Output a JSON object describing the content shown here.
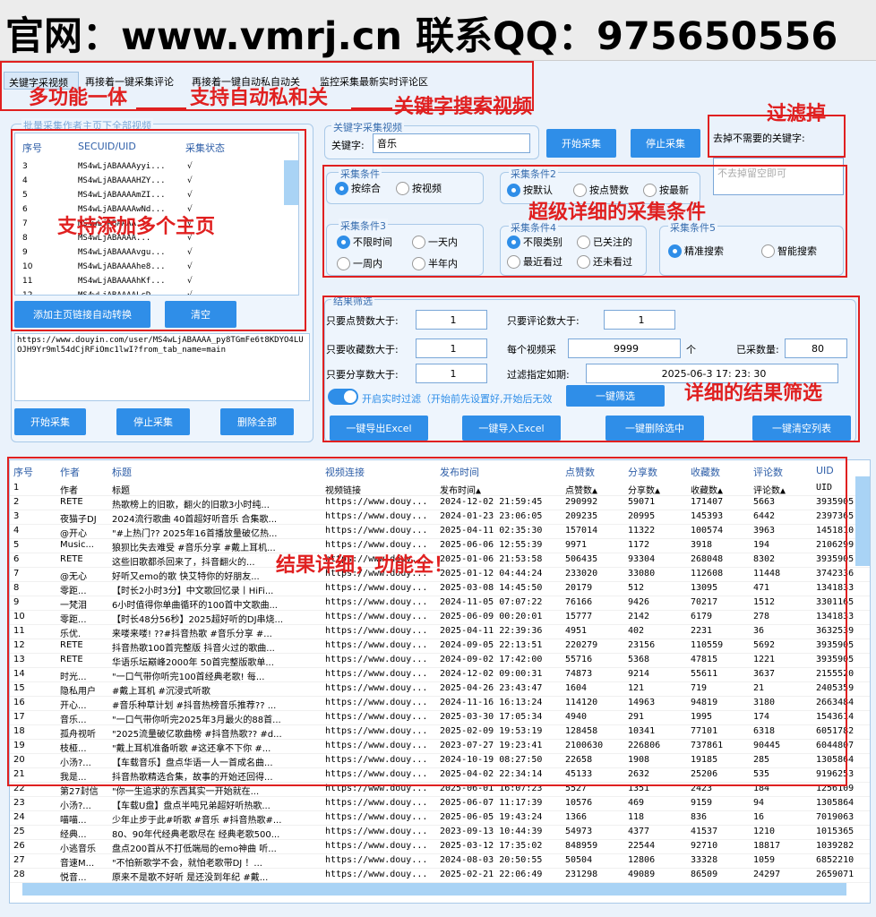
{
  "banner": "官网：www.vmrj.cn  联系QQ：975650556",
  "tabs": [
    "关键字采视频",
    "再接着一键采集评论",
    "再接着一键自动私自动关",
    "监控采集最新实时评论区"
  ],
  "annotations": {
    "multi": "多功能一体",
    "auto": "支持自动私和关",
    "keyword": "关键字搜索视频",
    "filter": "过滤掉",
    "homepage": "支持添加多个主页",
    "conditions": "超级详细的采集条件",
    "result_filter": "详细的结果筛选",
    "result_detail": "结果详细，功能全！"
  },
  "left_panel": {
    "title": "批量采集作者主页下全部视频",
    "headers": [
      "序号",
      "SECUID/UID",
      "采集状态"
    ],
    "rows": [
      {
        "no": "3",
        "uid": "MS4wLjABAAAAyyi...",
        "status": "√"
      },
      {
        "no": "4",
        "uid": "MS4wLjABAAAAHZY...",
        "status": "√"
      },
      {
        "no": "5",
        "uid": "MS4wLjABAAAAmZI...",
        "status": "√"
      },
      {
        "no": "6",
        "uid": "MS4wLjABAAAAwNd...",
        "status": "√"
      },
      {
        "no": "7",
        "uid": "MS4wLjABAAAA...",
        "status": "√"
      },
      {
        "no": "8",
        "uid": "MS4wLjABAAAA...",
        "status": "√"
      },
      {
        "no": "9",
        "uid": "MS4wLjABAAAAvgu...",
        "status": "√"
      },
      {
        "no": "10",
        "uid": "MS4wLjABAAAAhe8...",
        "status": "√"
      },
      {
        "no": "11",
        "uid": "MS4wLjABAAAAhKf...",
        "status": "√"
      },
      {
        "no": "12",
        "uid": "MS4wLjABAAAALcD...",
        "status": "√"
      }
    ],
    "add_btn": "添加主页链接自动转换",
    "clear_btn": "清空",
    "url_text": "https://www.douyin.com/user/MS4wLjABAAAA_py8TGmFe6t8KDYO4LUOJH9Yr9ml54dCjRFiOmc1lwI?from_tab_name=main",
    "start_btn": "开始采集",
    "stop_btn": "停止采集",
    "delete_btn": "删除全部"
  },
  "keyword": {
    "group": "关键字采集视频",
    "label": "关键字:",
    "value": "音乐",
    "start_btn": "开始采集",
    "stop_btn": "停止采集"
  },
  "exclude": {
    "label": "去掉不需要的关键字:",
    "placeholder": "不去掉留空即可"
  },
  "conditions": {
    "c1": {
      "title": "采集条件",
      "options": [
        "按综合",
        "按视频"
      ],
      "selected": 0
    },
    "c2": {
      "title": "采集条件2",
      "options": [
        "按默认",
        "按点赞数",
        "按最新"
      ],
      "selected": 0
    },
    "c3": {
      "title": "采集条件3",
      "options": [
        "不限时间",
        "一天内",
        "一周内",
        "半年内"
      ],
      "selected": 0
    },
    "c4": {
      "title": "采集条件4",
      "options": [
        "不限类别",
        "已关注的",
        "最近看过",
        "还未看过"
      ],
      "selected": 0
    },
    "c5": {
      "title": "采集条件5",
      "options": [
        "精准搜索",
        "智能搜索"
      ],
      "selected": 0
    }
  },
  "filter": {
    "group": "结果筛选",
    "likes_label": "只要点赞数大于:",
    "likes_value": "1",
    "comments_label": "只要评论数大于:",
    "comments_value": "1",
    "collects_label": "只要收藏数大于:",
    "collects_value": "1",
    "per_video_label": "每个视频采",
    "per_video_value": "9999",
    "per_video_unit": "个",
    "collected_label": "已采数量:",
    "collected_value": "80",
    "shares_label": "只要分享数大于:",
    "shares_value": "1",
    "expire_label": "过滤指定如期:",
    "expire_value": "2025-06-3  17: 23: 30",
    "realtime_label": "开启实时过滤（开始前先设置好,开始后无效",
    "filter_btn": "一键筛选",
    "export_btn": "一键导出Excel",
    "import_btn": "一键导入Excel",
    "delete_sel_btn": "一键删除选中",
    "clear_list_btn": "一键清空列表"
  },
  "table": {
    "headers": [
      "序号",
      "作者",
      "标题",
      "视频连接",
      "发布时间",
      "点赞数",
      "分享数",
      "收藏数",
      "评论数",
      "UID"
    ],
    "rows": [
      [
        "1",
        "作者",
        "标题",
        "视频链接",
        "发布时间▲",
        "点赞数▲",
        "分享数▲",
        "收藏数▲",
        "评论数▲",
        "UID"
      ],
      [
        "2",
        "RETE",
        "热歌榜上的旧歌，翻火的旧歌3小时纯...",
        "https://www.douy...",
        "2024-12-02 21:59:45",
        "290992",
        "59071",
        "171407",
        "5663",
        "3935905"
      ],
      [
        "3",
        "夜猫子DJ",
        "2024流行歌曲 40首超好听音乐 合集歌...",
        "https://www.douy...",
        "2024-01-23 23:06:05",
        "209235",
        "20995",
        "145393",
        "6442",
        "2397365"
      ],
      [
        "4",
        "@开心",
        "\"#上热门?? 2025年16首播放量破亿热...",
        "https://www.douy...",
        "2025-04-11 02:35:30",
        "157014",
        "11322",
        "100574",
        "3963",
        "1451810"
      ],
      [
        "5",
        "Music...",
        "狼狈比失去难受 #音乐分享 #戴上耳机...",
        "https://www.douy...",
        "2025-06-06 12:55:39",
        "9971",
        "1172",
        "3918",
        "194",
        "2106299"
      ],
      [
        "6",
        "RETE",
        "这些旧歌都杀回来了，抖音翻火的...",
        "https://www.douy...",
        "2025-01-06 21:53:58",
        "506435",
        "93304",
        "268048",
        "8302",
        "3935905"
      ],
      [
        "7",
        "@无心",
        "好听又emo的歌  快艾特你的好朋友...",
        "https://www.douy...",
        "2025-01-12 04:44:24",
        "233020",
        "33080",
        "112608",
        "11448",
        "3742336"
      ],
      [
        "8",
        "零距...",
        "【时长2小时3分】中文歌回忆录丨HiFi...",
        "https://www.douy...",
        "2025-03-08 14:45:50",
        "20179",
        "512",
        "13095",
        "471",
        "1341833"
      ],
      [
        "9",
        "一梵泪",
        "6小时值得你单曲循环的100首中文歌曲...",
        "https://www.douy...",
        "2024-11-05 07:07:22",
        "76166",
        "9426",
        "70217",
        "1512",
        "3301165"
      ],
      [
        "10",
        "零距...",
        "【时长48分56秒】2025超好听的DJ串烧...",
        "https://www.douy...",
        "2025-06-09 00:20:01",
        "15777",
        "2142",
        "6179",
        "278",
        "1341833"
      ],
      [
        "11",
        "乐优.",
        "来喽来喽! ??#抖音热歌 #音乐分享  #...",
        "https://www.douy...",
        "2025-04-11 22:39:36",
        "4951",
        "402",
        "2231",
        "36",
        "3632539"
      ],
      [
        "12",
        "RETE",
        "抖音热歌100首完整版 抖音火过的歌曲...",
        "https://www.douy...",
        "2024-09-05 22:13:51",
        "220279",
        "23156",
        "110559",
        "5692",
        "3935905"
      ],
      [
        "13",
        "RETE",
        "华语乐坛巅峰2000年 50首完整版歌单...",
        "https://www.douy...",
        "2024-09-02 17:42:00",
        "55716",
        "5368",
        "47815",
        "1221",
        "3935905"
      ],
      [
        "14",
        "时光...",
        "\"一口气带你听完100首经典老歌! 每...",
        "https://www.douy...",
        "2024-12-02 09:00:31",
        "74873",
        "9214",
        "55611",
        "3637",
        "2155520"
      ],
      [
        "15",
        "隐私用户",
        "#戴上耳机 #沉浸式听歌",
        "https://www.douy...",
        "2025-04-26 23:43:47",
        "1604",
        "121",
        "719",
        "21",
        "2405359"
      ],
      [
        "16",
        "开心...",
        "#音乐种草计划 #抖音热榜音乐推荐?? ...",
        "https://www.douy...",
        "2024-11-16 16:13:24",
        "114120",
        "14963",
        "94819",
        "3180",
        "2663484"
      ],
      [
        "17",
        "音乐...",
        "\"一口气带你听完2025年3月最火的88首...",
        "https://www.douy...",
        "2025-03-30 17:05:34",
        "4940",
        "291",
        "1995",
        "174",
        "1543614"
      ],
      [
        "18",
        "孤舟视听",
        "\"2025流量破亿歌曲榜 #抖音热歌?? #d...",
        "https://www.douy...",
        "2025-02-09 19:53:19",
        "128458",
        "10341",
        "77101",
        "6318",
        "6051782"
      ],
      [
        "19",
        "枝桠...",
        "\"戴上耳机准备听歌 #这还拿不下你 #...",
        "https://www.douy...",
        "2023-07-27 19:23:41",
        "2100630",
        "226806",
        "737861",
        "90445",
        "6044807"
      ],
      [
        "20",
        "小汤?...",
        "【车载音乐】盘点华语一人一首成名曲...",
        "https://www.douy...",
        "2024-10-19 08:27:50",
        "22658",
        "1908",
        "19185",
        "285",
        "1305864"
      ],
      [
        "21",
        "我是...",
        "抖音热歌精选合集，故事的开始还回得...",
        "https://www.douy...",
        "2025-04-02 22:34:14",
        "45133",
        "2632",
        "25206",
        "535",
        "9196253"
      ],
      [
        "22",
        "第27封信",
        "\"你一生追求的东西其实一开始就在...",
        "https://www.douy...",
        "2025-06-01 16:07:23",
        "5527",
        "1351",
        "2423",
        "184",
        "1256109"
      ],
      [
        "23",
        "小汤?...",
        "【车载U盘】盘点半吨兄弟超好听热歌...",
        "https://www.douy...",
        "2025-06-07 11:17:39",
        "10576",
        "469",
        "9159",
        "94",
        "1305864"
      ],
      [
        "24",
        "喵喵...",
        "少年止步于此#听歌 #音乐 #抖音热歌#...",
        "https://www.douy...",
        "2025-06-05 19:43:24",
        "1366",
        "118",
        "836",
        "16",
        "7019063"
      ],
      [
        "25",
        "经典...",
        "80、90年代经典老歌尽在 经典老歌500...",
        "https://www.douy...",
        "2023-09-13 10:44:39",
        "54973",
        "4377",
        "41537",
        "1210",
        "1015365"
      ],
      [
        "26",
        "小逃音乐",
        "盘点200首从不打低端局的emo神曲 听...",
        "https://www.douy...",
        "2025-03-12 17:35:02",
        "848959",
        "22544",
        "92710",
        "18817",
        "1039282"
      ],
      [
        "27",
        "音速M...",
        "\"不怕新歌学不会，就怕老歌带DJ ！...",
        "https://www.douy...",
        "2024-08-03 20:50:55",
        "50504",
        "12806",
        "33328",
        "1059",
        "6852210"
      ],
      [
        "28",
        "悦音...",
        "原来不是歌不好听 是还没到年纪 #戴...",
        "https://www.douy...",
        "2025-02-21 22:06:49",
        "231298",
        "49089",
        "86509",
        "24297",
        "2659071"
      ]
    ]
  }
}
